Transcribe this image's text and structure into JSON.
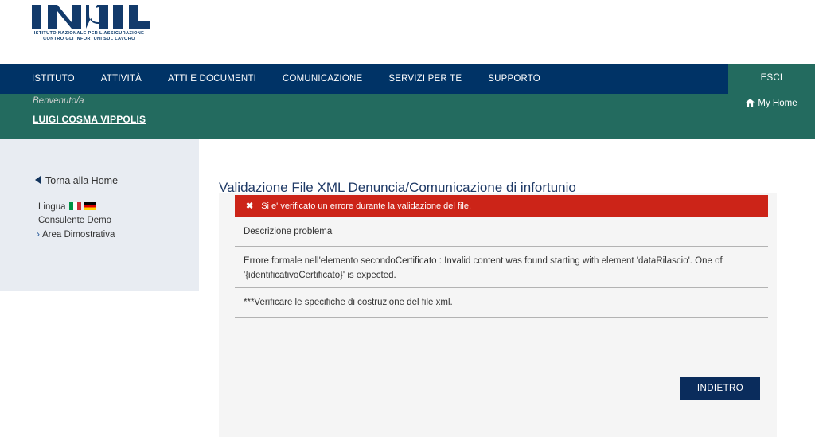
{
  "brand": {
    "logo_text": "INAIL",
    "logo_subtitle_line1": "ISTITUTO NAZIONALE PER L'ASSICURAZIONE",
    "logo_subtitle_line2": "CONTRO GLI INFORTUNI SUL LAVORO",
    "navy": "#003366",
    "teal": "#236b5f",
    "error_red": "#cc2418",
    "button_navy": "#0a2c5c"
  },
  "nav": {
    "items": [
      {
        "label": "ISTITUTO"
      },
      {
        "label": "ATTIVITÀ"
      },
      {
        "label": "ATTI E DOCUMENTI"
      },
      {
        "label": "COMUNICAZIONE"
      },
      {
        "label": "SERVIZI PER TE"
      },
      {
        "label": "SUPPORTO"
      }
    ]
  },
  "user_panel": {
    "logout_label": "ESCI",
    "my_home_label": "My Home",
    "my_home_icon": "home-icon"
  },
  "welcome": {
    "greeting": "Benvenuto/a",
    "user_name": "LUIGI COSMA VIPPOLIS"
  },
  "sidebar": {
    "back_home_label": "Torna alla Home",
    "back_home_icon": "triangle-left-icon",
    "lingua_label": "Lingua",
    "flags": [
      {
        "name": "flag-it-icon",
        "title": "Italiano"
      },
      {
        "name": "flag-de-icon",
        "title": "Deutsch"
      }
    ],
    "consulente_label": "Consulente Demo",
    "area_label": "Area Dimostrativa",
    "area_icon": "chevron-right-icon"
  },
  "main": {
    "page_title": "Validazione File XML Denuncia/Comunicazione di infortunio",
    "error_banner": {
      "icon": "close-x-icon",
      "message": "Si e' verificato un errore durante la validazione del file."
    },
    "rows": [
      {
        "label": "Descrizione problema"
      },
      {
        "label": "Errore formale nell'elemento secondoCertificato : Invalid content was found starting with element 'dataRilascio'. One of '{identificativoCertificato}' is expected."
      },
      {
        "label": "***Verificare le specifiche di costruzione del file xml."
      }
    ],
    "back_button_label": "INDIETRO"
  }
}
